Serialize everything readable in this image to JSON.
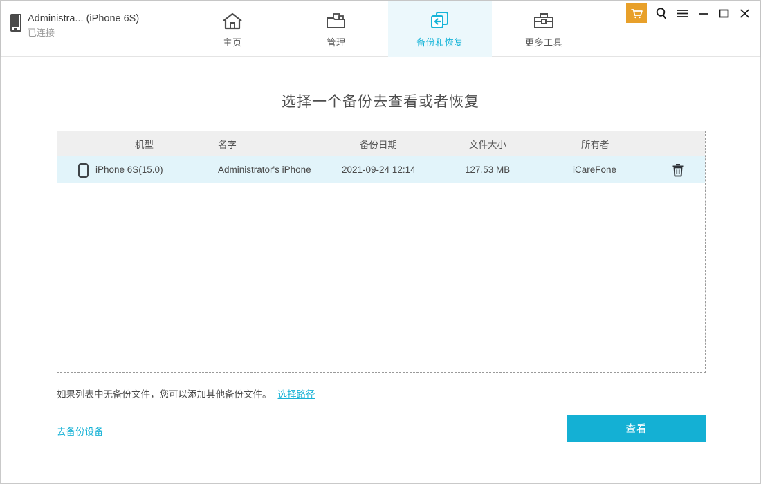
{
  "window": {
    "cart_icon": "shopping-cart-icon",
    "search_icon": "search-icon",
    "menu_icon": "hamburger-menu-icon",
    "minimize_icon": "minimize-icon",
    "maximize_icon": "maximize-icon",
    "close_icon": "close-icon"
  },
  "device": {
    "icon": "mobile-phone-icon",
    "name": "Administra... (iPhone 6S)",
    "status": "已连接"
  },
  "nav": {
    "tabs": [
      {
        "label": "主页",
        "icon": "home-icon",
        "active": false
      },
      {
        "label": "管理",
        "icon": "folder-files-icon",
        "active": false
      },
      {
        "label": "备份和恢复",
        "icon": "backup-restore-icon",
        "active": true
      },
      {
        "label": "更多工具",
        "icon": "toolbox-icon",
        "active": false
      }
    ]
  },
  "main": {
    "title": "选择一个备份去查看或者恢复",
    "table": {
      "columns": [
        "机型",
        "名字",
        "备份日期",
        "文件大小",
        "所有者"
      ],
      "rows": [
        {
          "icon": "mobile-phone-icon",
          "model": "iPhone 6S(15.0)",
          "name": "Administrator's iPhone",
          "date": "2021-09-24 12:14",
          "size": "127.53 MB",
          "owner": "iCareFone",
          "delete_icon": "trash-icon"
        }
      ]
    },
    "hint_text": "如果列表中无备份文件，您可以添加其他备份文件。",
    "hint_link": "选择路径",
    "backup_device_link": "去备份设备",
    "view_button": "查看"
  },
  "colors": {
    "accent": "#14b0d4",
    "accent_light": "#ecf8fc",
    "row_highlight": "#e2f4fa",
    "header_bg": "#efefef",
    "cart_orange": "#e8a02a"
  }
}
